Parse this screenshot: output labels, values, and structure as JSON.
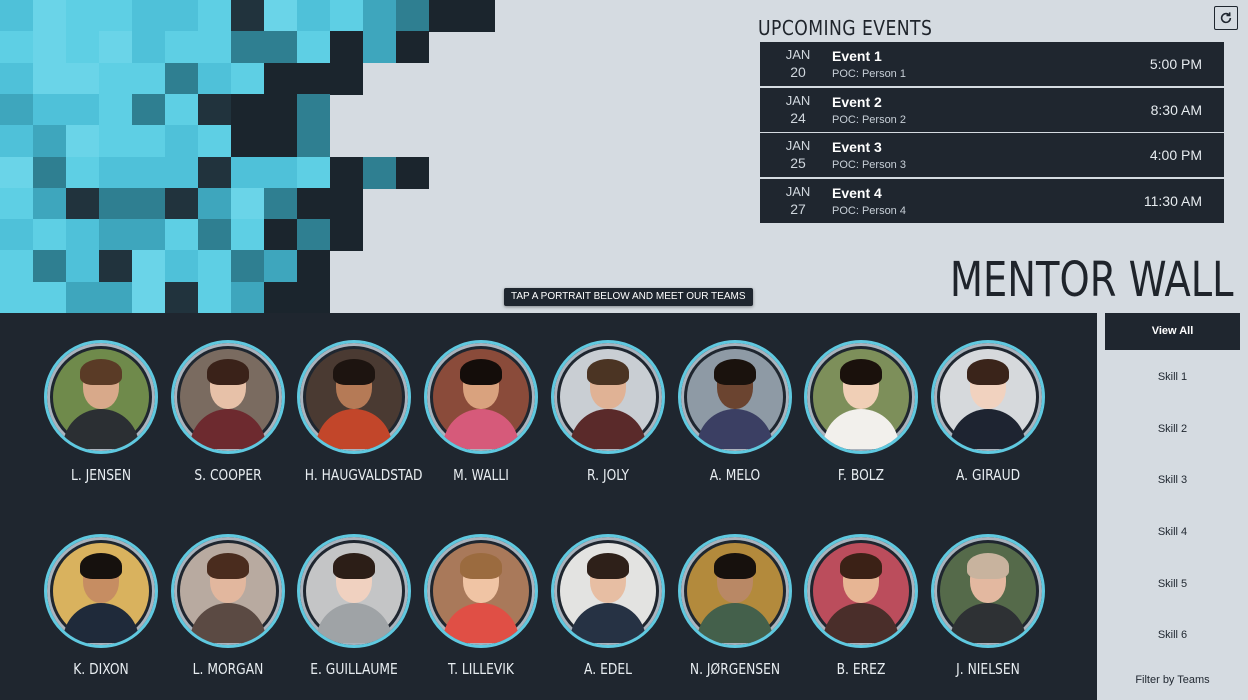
{
  "events": {
    "title": "UPCOMING EVENTS",
    "items": [
      {
        "month": "JAN",
        "day": "20",
        "name": "Event 1",
        "poc": "POC: Person 1",
        "time": "5:00 PM"
      },
      {
        "month": "JAN",
        "day": "24",
        "name": "Event 2",
        "poc": "POC: Person 2",
        "time": "8:30 AM"
      },
      {
        "month": "JAN",
        "day": "25",
        "name": "Event 3",
        "poc": "POC: Person 3",
        "time": "4:00 PM"
      },
      {
        "month": "JAN",
        "day": "27",
        "name": "Event 4",
        "poc": "POC: Person 4",
        "time": "11:30 AM"
      }
    ]
  },
  "refresh_icon": "refresh-icon",
  "title": "MENTOR WALL",
  "banner": "TAP A PORTRAIT BELOW AND MEET OUR TEAMS",
  "mentors": [
    {
      "name": "L. JENSEN",
      "bg": "#6f8a4b",
      "skin": "#d8a98a",
      "hair": "#5a3b26",
      "shirt": "#2b2f33"
    },
    {
      "name": "S. COOPER",
      "bg": "#7a6b60",
      "skin": "#e7c1a8",
      "hair": "#3a2219",
      "shirt": "#6d2a2f"
    },
    {
      "name": "H. HAUGVALDSTAD",
      "bg": "#4a3a32",
      "skin": "#b57a56",
      "hair": "#1d1410",
      "shirt": "#c2462a"
    },
    {
      "name": "M. WALLI",
      "bg": "#8a4b3a",
      "skin": "#d9a27e",
      "hair": "#140d0a",
      "shirt": "#d65a7a"
    },
    {
      "name": "R. JOLY",
      "bg": "#c9ced3",
      "skin": "#e0b295",
      "hair": "#4b3423",
      "shirt": "#5a2a2a"
    },
    {
      "name": "A. MELO",
      "bg": "#8e9aa5",
      "skin": "#6b4430",
      "hair": "#1a120d",
      "shirt": "#3b3f63"
    },
    {
      "name": "F. BOLZ",
      "bg": "#7d8f5a",
      "skin": "#f0cfb6",
      "hair": "#1a110c",
      "shirt": "#f2f0ec"
    },
    {
      "name": "A. GIRAUD",
      "bg": "#d6d9dc",
      "skin": "#f1d2bf",
      "hair": "#3a241a",
      "shirt": "#1e2431"
    },
    {
      "name": "K. DIXON",
      "bg": "#d9b25e",
      "skin": "#c68d62",
      "hair": "#16110e",
      "shirt": "#1f2a3a"
    },
    {
      "name": "L. MORGAN",
      "bg": "#b8aaa0",
      "skin": "#e2b79e",
      "hair": "#4a2c1e",
      "shirt": "#5b4a43"
    },
    {
      "name": "E. GUILLAUME",
      "bg": "#c4c5c6",
      "skin": "#f0d1c0",
      "hair": "#2c1e17",
      "shirt": "#9fa3a6"
    },
    {
      "name": "T. LILLEVIK",
      "bg": "#a9795a",
      "skin": "#f0c4a4",
      "hair": "#9b6b3f",
      "shirt": "#e04f45"
    },
    {
      "name": "A. EDEL",
      "bg": "#e3e3e1",
      "skin": "#e7bea3",
      "hair": "#2e2019",
      "shirt": "#263244"
    },
    {
      "name": "N. JØRGENSEN",
      "bg": "#b38a3c",
      "skin": "#b98865",
      "hair": "#17110d",
      "shirt": "#44604b"
    },
    {
      "name": "B. EREZ",
      "bg": "#bb4d5c",
      "skin": "#e7b594",
      "hair": "#3b2116",
      "shirt": "#4a2e2a"
    },
    {
      "name": "J. NIELSEN",
      "bg": "#556a4a",
      "skin": "#e3b8a0",
      "hair": "#c8b39e",
      "shirt": "#2e3134"
    }
  ],
  "sidebar": {
    "view_all": "View All",
    "skills": [
      "Skill 1",
      "Skill 2",
      "Skill 3",
      "Skill 4",
      "Skill 5",
      "Skill 6"
    ],
    "filter": "Filter by Teams"
  },
  "colors": {
    "accent": "#5fc9e0",
    "dark": "#1f262f",
    "light": "#d5dbe1"
  }
}
